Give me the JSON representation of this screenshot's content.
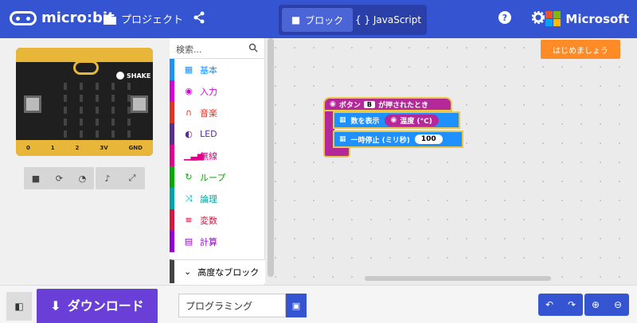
{
  "header": {
    "logo_text": "micro:bit",
    "projects_label": "プロジェクト",
    "tabs": [
      {
        "label": "ブロック",
        "active": true
      },
      {
        "label": "{ } JavaScript",
        "active": false
      }
    ],
    "brand": "Microsoft",
    "brand_colors": [
      "#f25022",
      "#7fba00",
      "#00a4ef",
      "#ffb900"
    ],
    "header_color": "#3454d1"
  },
  "simulator": {
    "shake_label": "SHAKE",
    "button_labels": {
      "a": "A",
      "b": "B"
    },
    "pins": [
      "0",
      "1",
      "2",
      "3V",
      "GND"
    ],
    "controls": [
      "stop-icon",
      "restart-icon",
      "slowmo-icon",
      "sound-icon",
      "fullscreen-icon"
    ]
  },
  "toolbox": {
    "search_placeholder": "検索...",
    "categories": [
      {
        "label": "基本",
        "color": "#1e90ff",
        "icon": "grid-icon"
      },
      {
        "label": "入力",
        "color": "#d400d4",
        "icon": "target-icon"
      },
      {
        "label": "音楽",
        "color": "#e63022",
        "icon": "headphones-icon"
      },
      {
        "label": "LED",
        "color": "#5c2d91",
        "icon": "toggle-icon"
      },
      {
        "label": "無線",
        "color": "#e3008c",
        "icon": "signal-icon"
      },
      {
        "label": "ループ",
        "color": "#00aa00",
        "icon": "loop-icon"
      },
      {
        "label": "論理",
        "color": "#00a4a6",
        "icon": "shuffle-icon"
      },
      {
        "label": "変数",
        "color": "#dc143c",
        "icon": "list-icon"
      },
      {
        "label": "計算",
        "color": "#9400d3",
        "icon": "calculator-icon"
      }
    ],
    "advanced_label": "高度なブロック"
  },
  "workspace": {
    "start_button": "はじめましょう",
    "event_block": {
      "prefix": "ボタン",
      "dropdown": "B",
      "suffix": "が押されたとき"
    },
    "show_number_label": "数を表示",
    "temperature_label": "温度 (°C)",
    "pause_label": "一時停止 (ミリ秒)",
    "pause_value": "100"
  },
  "bottom": {
    "download_label": "ダウンロード",
    "project_name": "プログラミング"
  }
}
